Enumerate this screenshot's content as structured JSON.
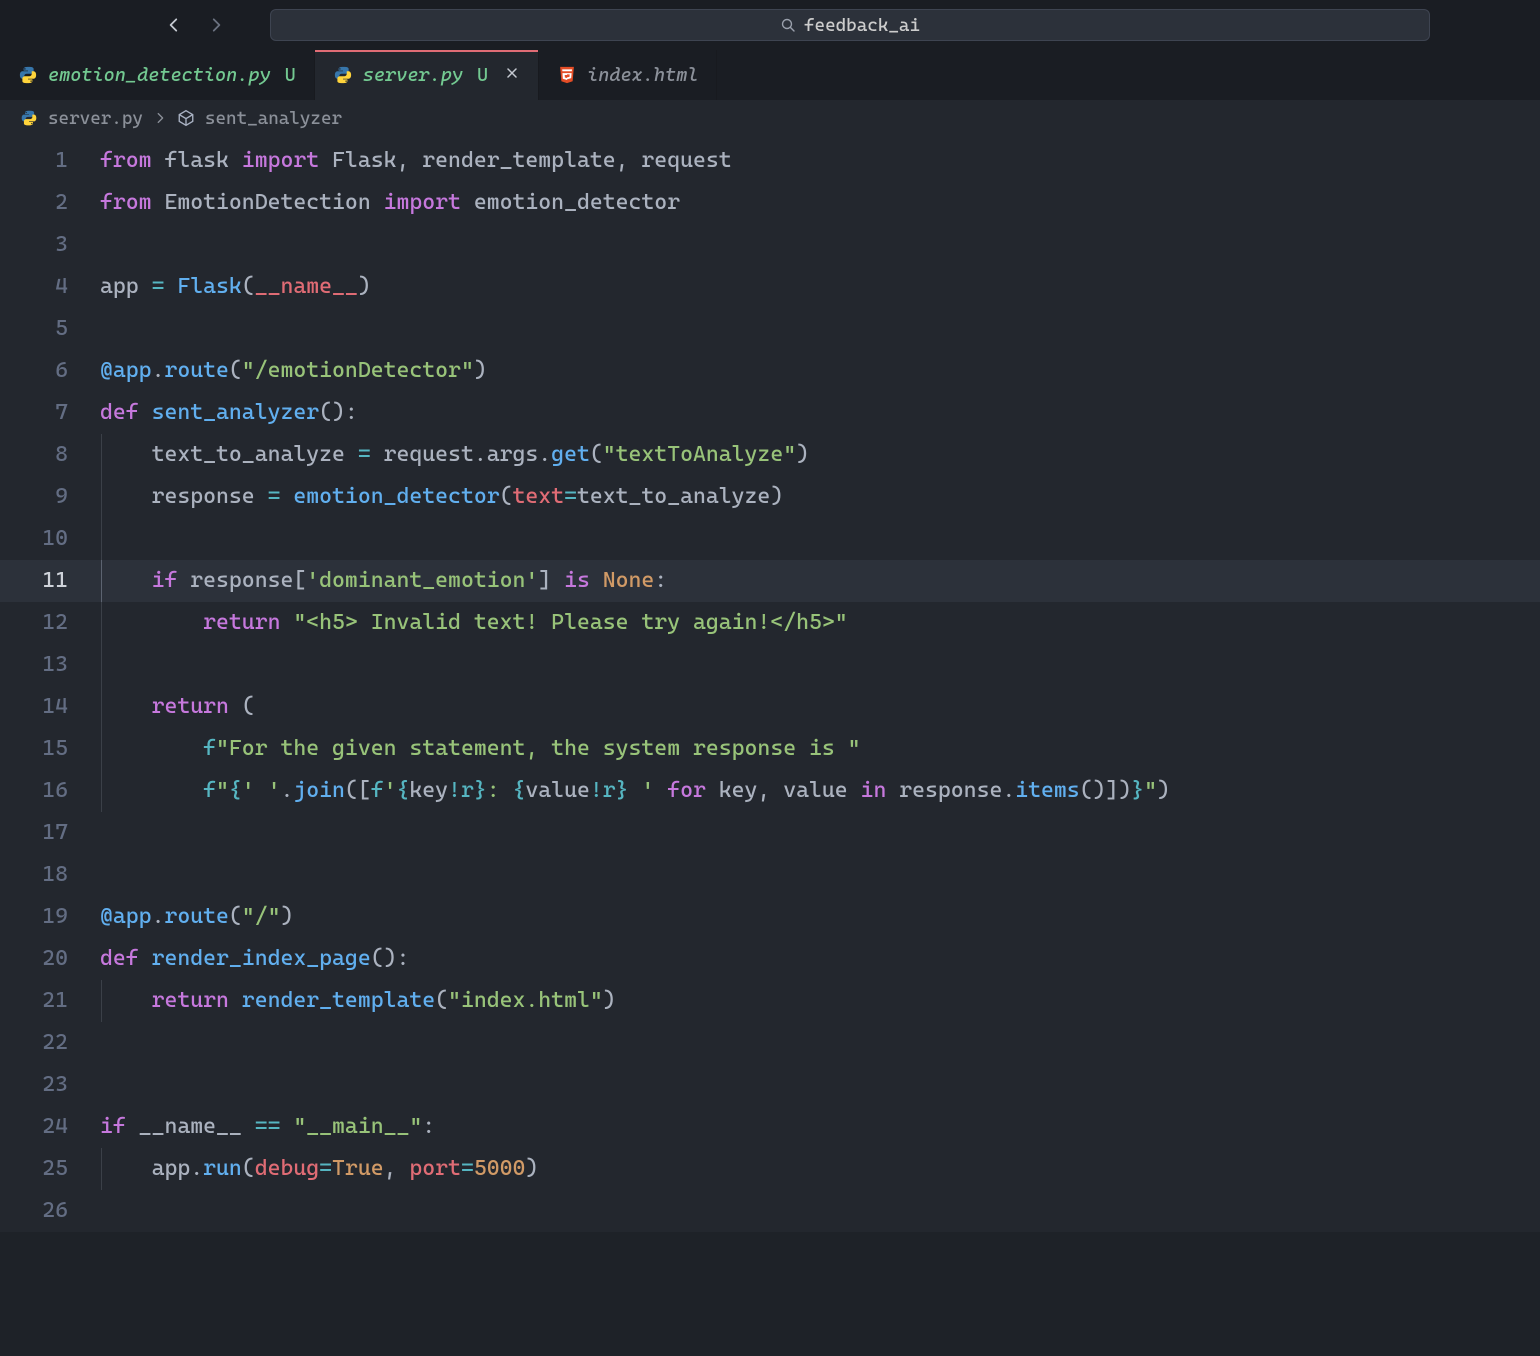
{
  "search": {
    "text": "feedback_ai"
  },
  "tabs": [
    {
      "label": "emotion_detection.py",
      "status": "U",
      "kind": "python",
      "modified": true
    },
    {
      "label": "server.py",
      "status": "U",
      "kind": "python",
      "modified": true,
      "active": true,
      "closeable": true
    },
    {
      "label": "index.html",
      "status": "",
      "kind": "html"
    }
  ],
  "breadcrumb": {
    "file": "server.py",
    "symbol": "sent_analyzer"
  },
  "code": {
    "lines": [
      {
        "n": 1,
        "tokens": [
          [
            "kw",
            "from"
          ],
          [
            "pn",
            " flask "
          ],
          [
            "kw",
            "import"
          ],
          [
            "pn",
            " Flask"
          ],
          [
            "pn",
            ", "
          ],
          [
            "pn",
            "render_template"
          ],
          [
            "pn",
            ", "
          ],
          [
            "pn",
            "request"
          ]
        ]
      },
      {
        "n": 2,
        "tokens": [
          [
            "kw",
            "from"
          ],
          [
            "pn",
            " EmotionDetection "
          ],
          [
            "kw",
            "import"
          ],
          [
            "pn",
            " emotion_detector"
          ]
        ]
      },
      {
        "n": 3,
        "tokens": []
      },
      {
        "n": 4,
        "tokens": [
          [
            "pn",
            "app "
          ],
          [
            "op",
            "="
          ],
          [
            "pn",
            " "
          ],
          [
            "fn",
            "Flask"
          ],
          [
            "pn",
            "("
          ],
          [
            "var",
            "__name__"
          ],
          [
            "pn",
            ")"
          ]
        ]
      },
      {
        "n": 5,
        "tokens": []
      },
      {
        "n": 6,
        "tokens": [
          [
            "fn",
            "@app"
          ],
          [
            "pn",
            "."
          ],
          [
            "fn",
            "route"
          ],
          [
            "pn",
            "("
          ],
          [
            "str",
            "\"/emotionDetector\""
          ],
          [
            "pn",
            ")"
          ]
        ]
      },
      {
        "n": 7,
        "tokens": [
          [
            "kw",
            "def"
          ],
          [
            "pn",
            " "
          ],
          [
            "fn",
            "sent_analyzer"
          ],
          [
            "pn",
            "():"
          ]
        ]
      },
      {
        "n": 8,
        "indent": 1,
        "tokens": [
          [
            "pn",
            "text_to_analyze "
          ],
          [
            "op",
            "="
          ],
          [
            "pn",
            " request.args."
          ],
          [
            "fn",
            "get"
          ],
          [
            "pn",
            "("
          ],
          [
            "str",
            "\"textToAnalyze\""
          ],
          [
            "pn",
            ")"
          ]
        ]
      },
      {
        "n": 9,
        "indent": 1,
        "tokens": [
          [
            "pn",
            "response "
          ],
          [
            "op",
            "="
          ],
          [
            "pn",
            " "
          ],
          [
            "fn",
            "emotion_detector"
          ],
          [
            "pn",
            "("
          ],
          [
            "var",
            "text"
          ],
          [
            "op",
            "="
          ],
          [
            "pn",
            "text_to_analyze)"
          ]
        ]
      },
      {
        "n": 10,
        "indent": 1,
        "tokens": []
      },
      {
        "n": 11,
        "indent": 1,
        "active": true,
        "tokens": [
          [
            "kw",
            "if"
          ],
          [
            "pn",
            " response["
          ],
          [
            "str",
            "'dominant_emotion'"
          ],
          [
            "pn",
            "] "
          ],
          [
            "kw",
            "is"
          ],
          [
            "pn",
            " "
          ],
          [
            "num",
            "None"
          ],
          [
            "pn",
            ":"
          ]
        ]
      },
      {
        "n": 12,
        "indent": 2,
        "tokens": [
          [
            "kw",
            "return"
          ],
          [
            "pn",
            " "
          ],
          [
            "str",
            "\"<h5> Invalid text! Please try again!</h5>\""
          ]
        ]
      },
      {
        "n": 13,
        "indent": 1,
        "tokens": []
      },
      {
        "n": 14,
        "indent": 1,
        "tokens": [
          [
            "kw",
            "return"
          ],
          [
            "pn",
            " ("
          ]
        ]
      },
      {
        "n": 15,
        "indent": 2,
        "tokens": [
          [
            "op",
            "f"
          ],
          [
            "str",
            "\"For the given statement, the system response is \""
          ]
        ]
      },
      {
        "n": 16,
        "indent": 2,
        "tokens": [
          [
            "op",
            "f"
          ],
          [
            "str",
            "\""
          ],
          [
            "op",
            "{"
          ],
          [
            "str",
            "' '"
          ],
          [
            "pn",
            "."
          ],
          [
            "fn",
            "join"
          ],
          [
            "pn",
            "(["
          ],
          [
            "op",
            "f"
          ],
          [
            "str",
            "'"
          ],
          [
            "op",
            "{"
          ],
          [
            "pn",
            "key"
          ],
          [
            "op",
            "!r}"
          ],
          [
            "str",
            ": "
          ],
          [
            "op",
            "{"
          ],
          [
            "pn",
            "value"
          ],
          [
            "op",
            "!r}"
          ],
          [
            "str",
            " '"
          ],
          [
            "pn",
            " "
          ],
          [
            "kw",
            "for"
          ],
          [
            "pn",
            " key, value "
          ],
          [
            "kw",
            "in"
          ],
          [
            "pn",
            " response."
          ],
          [
            "fn",
            "items"
          ],
          [
            "pn",
            "()])"
          ],
          [
            "op",
            "}"
          ],
          [
            "str",
            "\""
          ],
          [
            "pn",
            ")"
          ]
        ]
      },
      {
        "n": 17,
        "tokens": []
      },
      {
        "n": 18,
        "tokens": []
      },
      {
        "n": 19,
        "tokens": [
          [
            "fn",
            "@app"
          ],
          [
            "pn",
            "."
          ],
          [
            "fn",
            "route"
          ],
          [
            "pn",
            "("
          ],
          [
            "str",
            "\"/\""
          ],
          [
            "pn",
            ")"
          ]
        ]
      },
      {
        "n": 20,
        "tokens": [
          [
            "kw",
            "def"
          ],
          [
            "pn",
            " "
          ],
          [
            "fn",
            "render_index_page"
          ],
          [
            "pn",
            "():"
          ]
        ]
      },
      {
        "n": 21,
        "indent": 1,
        "tokens": [
          [
            "kw",
            "return"
          ],
          [
            "pn",
            " "
          ],
          [
            "fn",
            "render_template"
          ],
          [
            "pn",
            "("
          ],
          [
            "str",
            "\"index.html\""
          ],
          [
            "pn",
            ")"
          ]
        ]
      },
      {
        "n": 22,
        "tokens": []
      },
      {
        "n": 23,
        "tokens": []
      },
      {
        "n": 24,
        "tokens": [
          [
            "kw",
            "if"
          ],
          [
            "pn",
            " __name__ "
          ],
          [
            "op",
            "=="
          ],
          [
            "pn",
            " "
          ],
          [
            "str",
            "\"__main__\""
          ],
          [
            "pn",
            ":"
          ]
        ]
      },
      {
        "n": 25,
        "indent": 1,
        "tokens": [
          [
            "pn",
            "app."
          ],
          [
            "fn",
            "run"
          ],
          [
            "pn",
            "("
          ],
          [
            "var",
            "debug"
          ],
          [
            "op",
            "="
          ],
          [
            "num",
            "True"
          ],
          [
            "pn",
            ", "
          ],
          [
            "var",
            "port"
          ],
          [
            "op",
            "="
          ],
          [
            "num",
            "5000"
          ],
          [
            "pn",
            ")"
          ]
        ]
      },
      {
        "n": 26,
        "tokens": []
      }
    ]
  }
}
